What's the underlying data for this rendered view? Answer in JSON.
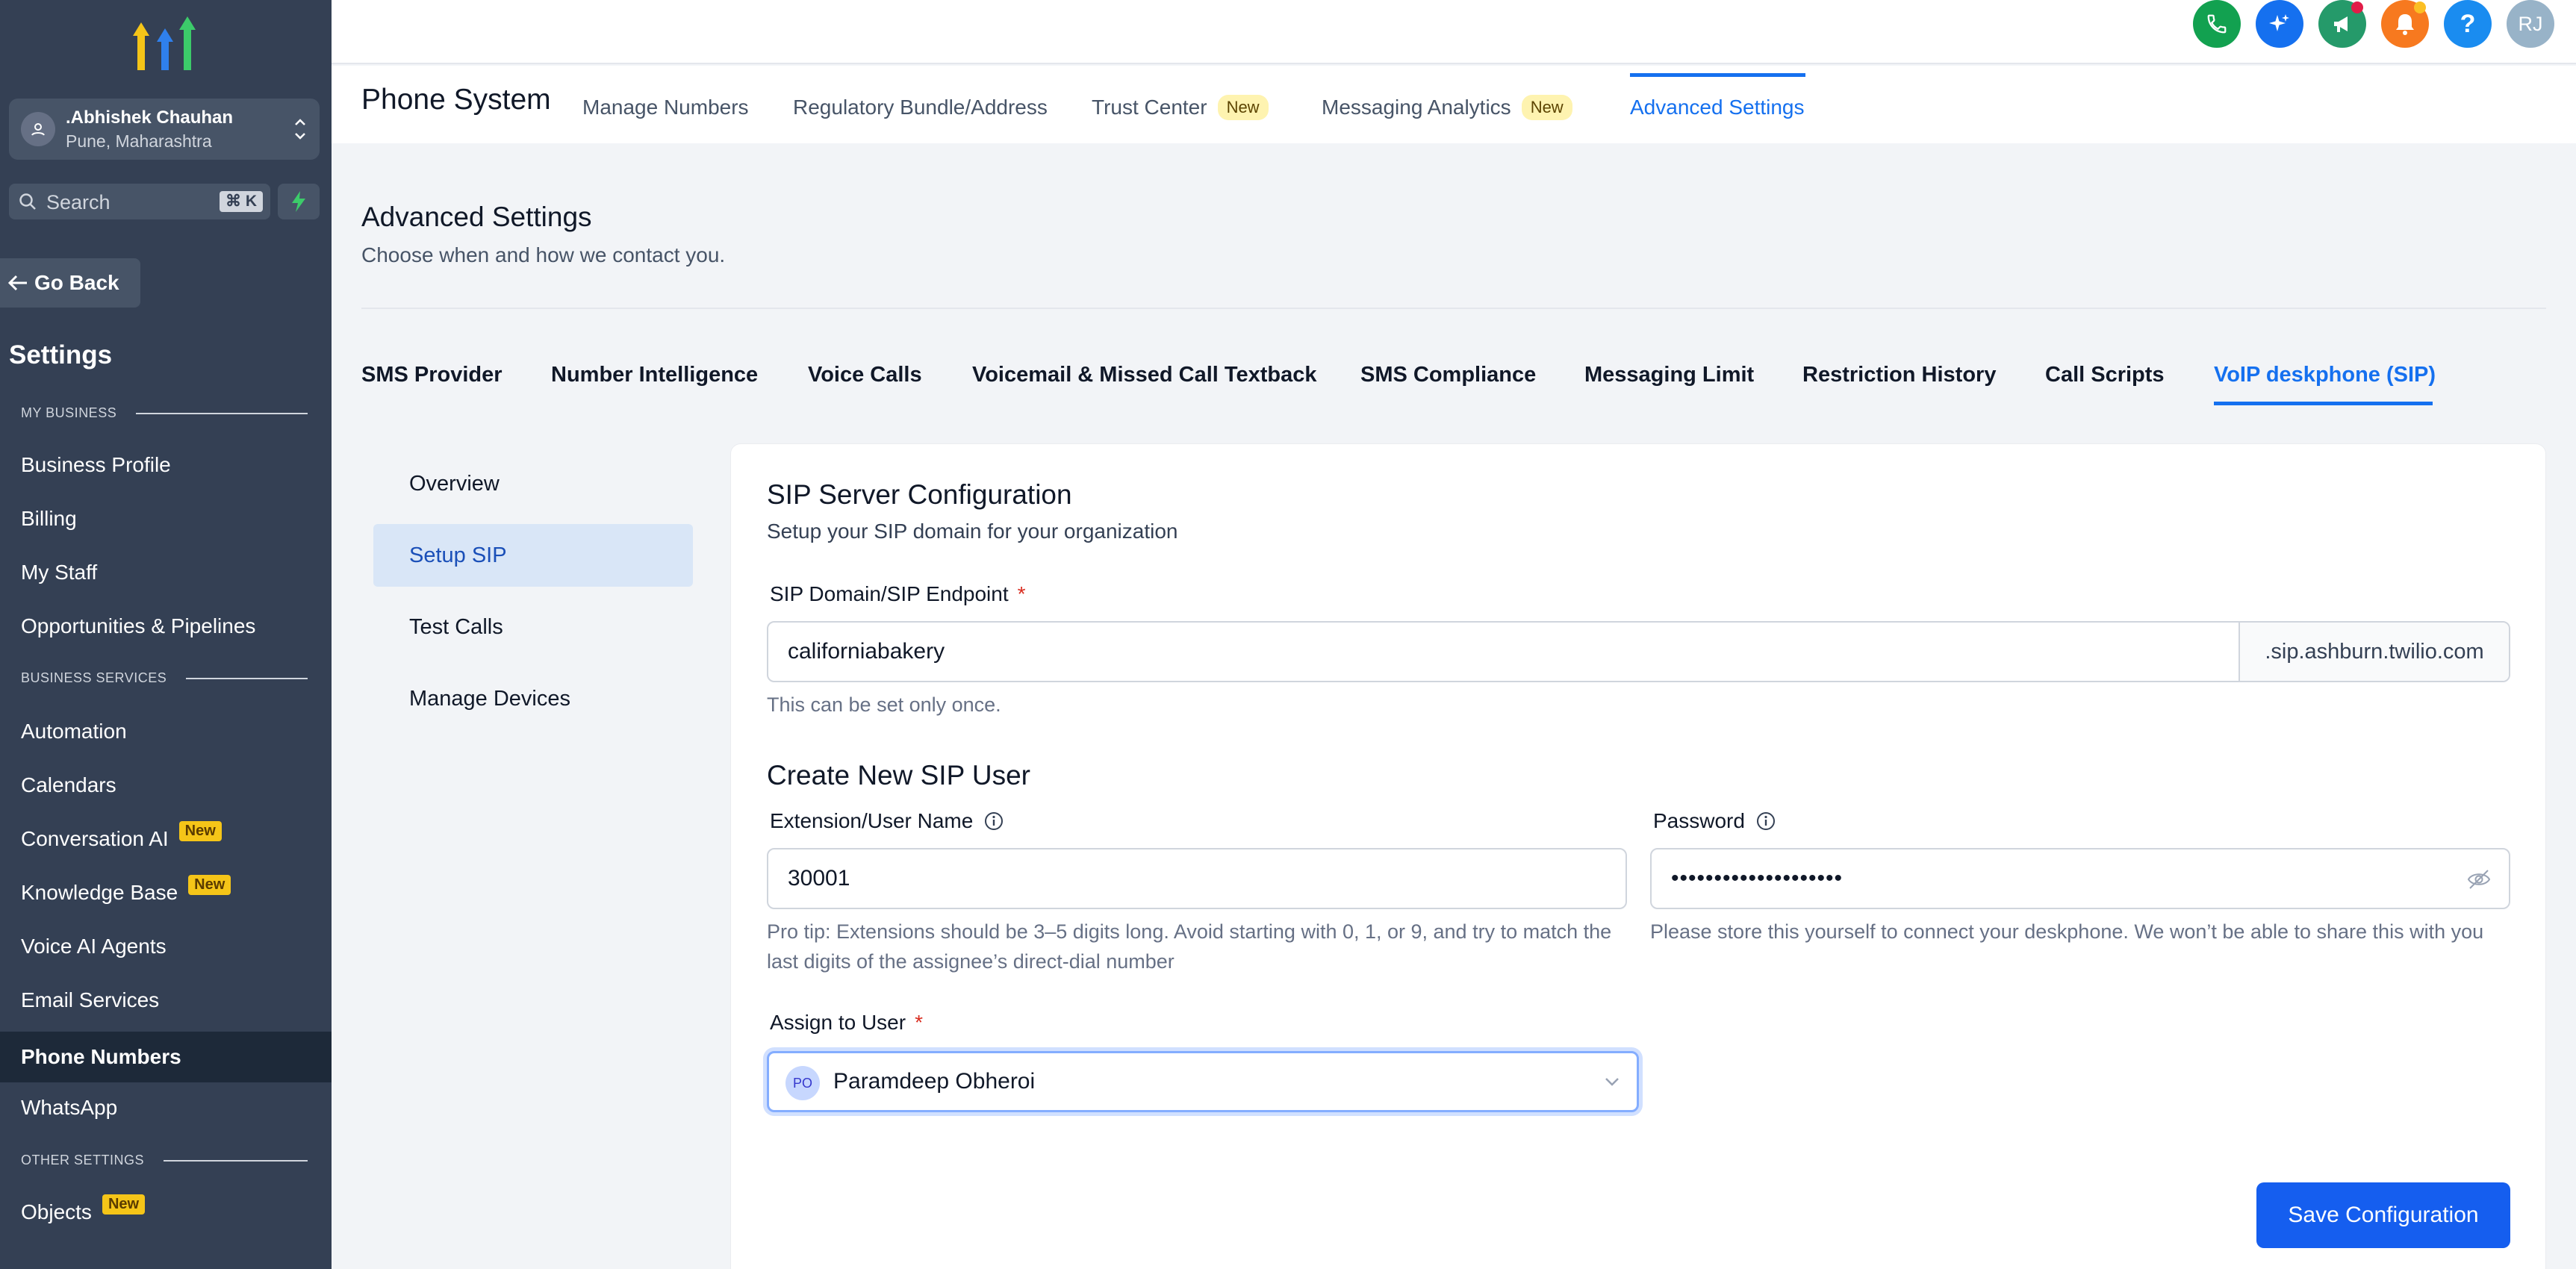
{
  "sidebar": {
    "location": {
      "name": ".Abhishek Chauhan",
      "sub": "Pune, Maharashtra"
    },
    "search": {
      "placeholder": "Search",
      "shortcut": "⌘ K"
    },
    "go_back": "Go Back",
    "title": "Settings",
    "sections": {
      "my_business": "MY BUSINESS",
      "business_services": "BUSINESS SERVICES",
      "other_settings": "OTHER SETTINGS"
    },
    "items": [
      {
        "label": "Business Profile"
      },
      {
        "label": "Billing"
      },
      {
        "label": "My Staff"
      },
      {
        "label": "Opportunities & Pipelines"
      },
      {
        "label": "Automation"
      },
      {
        "label": "Calendars"
      },
      {
        "label": "Conversation AI",
        "badge": "New"
      },
      {
        "label": "Knowledge Base",
        "badge": "New"
      },
      {
        "label": "Voice AI Agents"
      },
      {
        "label": "Email Services"
      },
      {
        "label": "Phone Numbers",
        "active": true
      },
      {
        "label": "WhatsApp"
      },
      {
        "label": "Objects",
        "badge": "New"
      }
    ]
  },
  "topbar": {
    "avatar_initials": "RJ",
    "help_glyph": "?",
    "colors": {
      "phone": "#12a150",
      "sparkle": "#1570ef",
      "megaphone": "#259a6a",
      "bell": "#f7791f",
      "help": "#1a8cf0",
      "avatar": "#98b3c8"
    }
  },
  "phone_system": {
    "title": "Phone System",
    "tabs": [
      {
        "label": "Manage Numbers"
      },
      {
        "label": "Regulatory Bundle/Address"
      },
      {
        "label": "Trust Center",
        "badge": "New"
      },
      {
        "label": "Messaging Analytics",
        "badge": "New"
      },
      {
        "label": "Advanced Settings",
        "active": true
      }
    ]
  },
  "advanced": {
    "title": "Advanced Settings",
    "subtitle": "Choose when and how we contact you.",
    "tabs": [
      {
        "label": "SMS Provider"
      },
      {
        "label": "Number Intelligence"
      },
      {
        "label": "Voice Calls"
      },
      {
        "label": "Voicemail & Missed Call Textback"
      },
      {
        "label": "SMS Compliance"
      },
      {
        "label": "Messaging Limit"
      },
      {
        "label": "Restriction History"
      },
      {
        "label": "Call Scripts"
      },
      {
        "label": "VoIP deskphone (SIP)",
        "active": true
      }
    ]
  },
  "sip_nav": [
    {
      "label": "Overview"
    },
    {
      "label": "Setup SIP",
      "active": true
    },
    {
      "label": "Test Calls"
    },
    {
      "label": "Manage Devices"
    }
  ],
  "sip_config": {
    "title": "SIP Server Configuration",
    "subtitle": "Setup your SIP domain for your organization",
    "domain_label": "SIP Domain/SIP Endpoint",
    "required_mark": "*",
    "domain_value": "californiabakery",
    "domain_suffix": ".sip.ashburn.twilio.com",
    "domain_help": "This can be set only once.",
    "create_title": "Create New SIP User",
    "extension_label": "Extension/User Name",
    "extension_value": "30001",
    "extension_help": "Pro tip: Extensions should be 3–5 digits long. Avoid starting with 0, 1, or 9, and try to match the last digits of the assignee’s direct-dial number",
    "password_label": "Password",
    "password_value": "••••••••••••••••••••",
    "password_help": "Please store this yourself to connect your deskphone. We won’t be able to share this with you",
    "assign_label": "Assign to User",
    "assign_initials": "PO",
    "assign_value": "Paramdeep Obheroi",
    "save_label": "Save Configuration"
  }
}
